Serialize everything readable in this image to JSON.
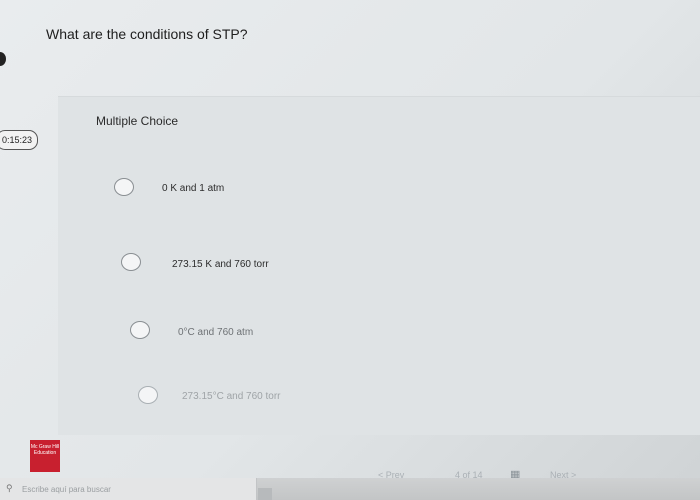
{
  "question": {
    "text": "What are the conditions of STP?"
  },
  "timer": {
    "text": "0:15:23"
  },
  "quiz": {
    "type_label": "Multiple Choice",
    "options": [
      {
        "label": "0 K and 1 atm"
      },
      {
        "label": "273.15 K and 760 torr"
      },
      {
        "label": "0°C and 760 atm"
      },
      {
        "label": "273.15°C and 760 torr"
      }
    ]
  },
  "navigation": {
    "prev_label": "< Prev",
    "page_label": "4 of 14",
    "next_label": "Next >"
  },
  "taskbar": {
    "search_placeholder": "Escribe aquí para buscar"
  },
  "logo": {
    "text": "Mc Graw Hill Education"
  },
  "colors": {
    "logo_red": "#c8202f",
    "panel": "#dfe3e5"
  }
}
